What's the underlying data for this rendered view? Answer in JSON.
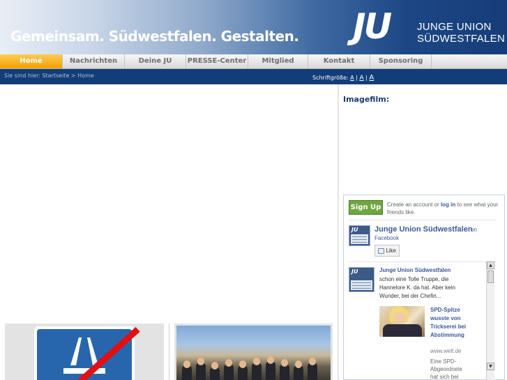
{
  "header": {
    "slogan": "Gemeinsam. Südwestfalen. Gestalten.",
    "logo_text": "JU",
    "org_line1": "JUNGE UNION",
    "org_line2": "SÜDWESTFALEN"
  },
  "nav": {
    "items": [
      {
        "label": "Home",
        "active": true
      },
      {
        "label": "Nachrichten",
        "active": false
      },
      {
        "label": "Deine JU",
        "active": false
      },
      {
        "label": "PRESSE-Center",
        "active": false
      },
      {
        "label": "Mitglied werden",
        "active": false
      },
      {
        "label": "Kontakt",
        "active": false
      },
      {
        "label": "Sponsoring",
        "active": false
      }
    ]
  },
  "breadcrumb": {
    "prefix": "Sie sind hier:",
    "start": "Startseite",
    "separator": ">",
    "current": "Home"
  },
  "fontsize": {
    "label": "Schriftgröße:",
    "options": [
      "A",
      "A",
      "A"
    ],
    "sep": "|"
  },
  "sidebar": {
    "imagefilm_label": "Imagefilm:"
  },
  "facebook": {
    "signup_label": "Sign Up",
    "create_prefix": "Create an account or",
    "create_login": "log in",
    "create_suffix": "to see what your friends like.",
    "page_name": "Junge Union Südwestfalen",
    "on_label": "on",
    "facebook_label": "Facebook",
    "like_label": "Like",
    "post": {
      "author": "Junge Union Südwestfalen",
      "text": "schon eine Tolle Truppe, die Hannelore K. da hat. Aber kein Wunder, bei der Chefin...",
      "link_title": "SPD-Spitze wusste von Trickserei bei Abstimmung",
      "source": "www.welt.de",
      "excerpt": "Eine SPD-Abgeordnete hat sich bei"
    }
  },
  "colors": {
    "nav_active": "#f3a100",
    "header_dark": "#163d78",
    "fb_blue": "#3b5998",
    "signup_green": "#6fa640"
  }
}
